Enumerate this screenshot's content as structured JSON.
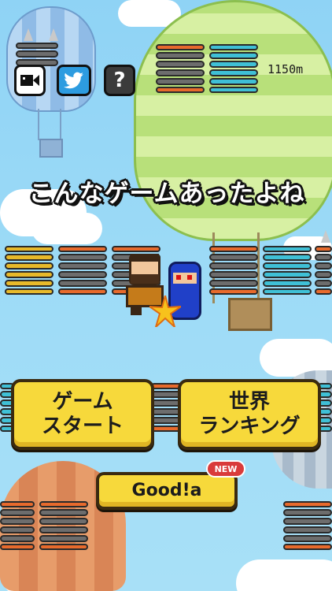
{
  "hud": {
    "distance": "1150m",
    "help_label": "?"
  },
  "title": "こんなゲームあったよね",
  "buttons": {
    "start": "ゲーム\nスタート",
    "ranking": "世界\nランキング",
    "good": "Good!a",
    "new_badge": "NEW"
  },
  "colors": {
    "sky": "#8fd3f5",
    "button": "#f7d93b",
    "spring_orange": "#e86a2c",
    "spring_gray": "#6d6d6d",
    "spring_cyan": "#3fc0d6",
    "spring_gold": "#e8b92a",
    "new_badge": "#d93b3b"
  },
  "icons": [
    "video-icon",
    "twitter-bird-icon",
    "help-icon"
  ]
}
